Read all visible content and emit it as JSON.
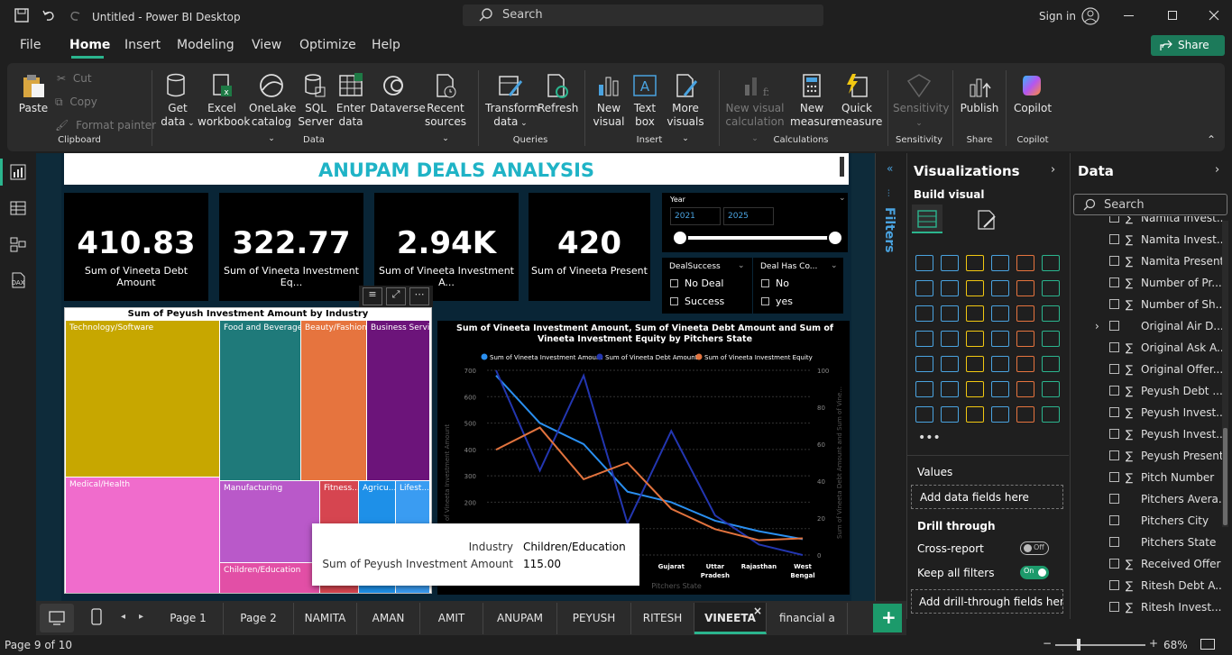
{
  "window": {
    "title": "Untitled - Power BI Desktop",
    "search_placeholder": "Search",
    "sign_in": "Sign in"
  },
  "menu": [
    "File",
    "Home",
    "Insert",
    "Modeling",
    "View",
    "Optimize",
    "Help"
  ],
  "share": "Share",
  "ribbon": {
    "clipboard": {
      "paste": "Paste",
      "cut": "Cut",
      "copy": "Copy",
      "format_painter": "Format painter",
      "group": "Clipboard"
    },
    "data": {
      "get_data": [
        "Get",
        "data"
      ],
      "excel": [
        "Excel",
        "workbook"
      ],
      "onelake": [
        "OneLake",
        "catalog"
      ],
      "sql": [
        "SQL",
        "Server"
      ],
      "enter": [
        "Enter",
        "data"
      ],
      "dataverse": "Dataverse",
      "recent": [
        "Recent",
        "sources"
      ],
      "group": "Data"
    },
    "queries": {
      "transform": [
        "Transform",
        "data"
      ],
      "refresh": "Refresh",
      "group": "Queries"
    },
    "insert": {
      "new_visual": [
        "New",
        "visual"
      ],
      "text_box": [
        "Text",
        "box"
      ],
      "more_visuals": [
        "More",
        "visuals"
      ],
      "group": "Insert"
    },
    "calculations": {
      "new_visual_calc": [
        "New visual",
        "calculation"
      ],
      "new_measure": [
        "New",
        "measure"
      ],
      "quick_measure": [
        "Quick",
        "measure"
      ],
      "group": "Calculations"
    },
    "sensitivity": {
      "label": "Sensitivity",
      "group": "Sensitivity"
    },
    "share": {
      "publish": "Publish",
      "group": "Share"
    },
    "copilot": {
      "label": "Copilot",
      "group": "Copilot"
    }
  },
  "report": {
    "title": "ANUPAM DEALS ANALYSIS",
    "kpis": [
      {
        "value": "410.83",
        "label": "Sum of Vineeta Debt Amount"
      },
      {
        "value": "322.77",
        "label": "Sum of Vineeta Investment Eq..."
      },
      {
        "value": "2.94K",
        "label": "Sum of Vineeta Investment A..."
      },
      {
        "value": "420",
        "label": "Sum of Vineeta Present"
      }
    ],
    "year_slicer": {
      "title": "Year",
      "from": "2021",
      "to": "2025"
    },
    "deal_success": {
      "title": "DealSuccess",
      "options": [
        "No Deal",
        "Success"
      ]
    },
    "deal_has_co": {
      "title": "Deal Has Co...",
      "options": [
        "No",
        "yes"
      ]
    },
    "treemap": {
      "title": "Sum of Peyush Investment Amount by Industry",
      "tiles": [
        "Technology/Software",
        "Food and Beverage",
        "Beauty/Fashion",
        "Business Servi...",
        "Medical/Health",
        "Manufacturing",
        "Fitness...",
        "Agricu...",
        "Lifest...",
        "Children/Education"
      ]
    },
    "tooltip": {
      "k1": "Industry",
      "v1": "Children/Education",
      "k2": "Sum of Peyush Investment Amount",
      "v2": "115.00"
    },
    "line_chart_title": "Sum of Vineeta Investment Amount, Sum of Vineeta Debt Amount and Sum of Vineeta Investment Equity by Pitchers State"
  },
  "chart_data": {
    "type": "line",
    "title": "Sum of Vineeta Investment Amount, Sum of Vineeta Debt Amount and Sum of Vineeta Investment Equity by Pitchers State",
    "xlabel": "Pitchers State",
    "ylabel": "Sum of Vineeta Investment Amount",
    "y2label": "Sum of Vineeta Debt Amount and Sum of Vine...",
    "categories": [
      "",
      "",
      "",
      "",
      "Gujarat",
      "Uttar Pradesh",
      "Rajasthan",
      "West Bengal"
    ],
    "series": [
      {
        "name": "Sum of Vineeta Investment Amount",
        "axis": "left",
        "color": "#2a8ff0",
        "values": [
          680,
          500,
          420,
          240,
          200,
          130,
          90,
          60
        ]
      },
      {
        "name": "Sum of Vineeta Debt Amount",
        "axis": "left",
        "color": "#2336b0",
        "values": [
          700,
          320,
          680,
          120,
          470,
          150,
          40,
          0
        ]
      },
      {
        "name": "Sum of Vineeta Investment Equity",
        "axis": "right",
        "color": "#e2733e",
        "values": [
          57,
          69,
          41,
          50,
          25,
          14,
          8,
          9
        ]
      }
    ],
    "ylim": [
      0,
      700
    ],
    "y2lim": [
      0,
      100
    ],
    "yticks": [
      "0",
      "100",
      "200",
      "300",
      "400",
      "500",
      "600",
      "700"
    ],
    "y2ticks": [
      "0",
      "20",
      "40",
      "60",
      "80",
      "100"
    ],
    "legend": "top"
  },
  "filters_label": "Filters",
  "visualizations": {
    "title": "Visualizations",
    "build_visual": "Build visual",
    "values": "Values",
    "add_data": "Add data fields here",
    "drill_through": "Drill through",
    "cross_report": "Cross-report",
    "cross_report_state": "Off",
    "keep_filters": "Keep all filters",
    "keep_filters_state": "On",
    "add_drill": "Add drill-through fields here"
  },
  "data_pane": {
    "title": "Data",
    "search_placeholder": "Search",
    "fields": [
      {
        "name": "Namita Invest...",
        "sigma": true
      },
      {
        "name": "Namita Invest...",
        "sigma": true
      },
      {
        "name": "Namita Present",
        "sigma": true
      },
      {
        "name": "Number of Pr...",
        "sigma": true
      },
      {
        "name": "Number of Sh...",
        "sigma": true
      },
      {
        "name": "Original Air D...",
        "sigma": false
      },
      {
        "name": "Original Ask A...",
        "sigma": true
      },
      {
        "name": "Original Offer...",
        "sigma": true
      },
      {
        "name": "Peyush Debt ...",
        "sigma": true
      },
      {
        "name": "Peyush Invest...",
        "sigma": true
      },
      {
        "name": "Peyush Invest...",
        "sigma": true
      },
      {
        "name": "Peyush Present",
        "sigma": true
      },
      {
        "name": "Pitch Number",
        "sigma": true
      },
      {
        "name": "Pitchers Avera...",
        "sigma": false
      },
      {
        "name": "Pitchers City",
        "sigma": false
      },
      {
        "name": "Pitchers State",
        "sigma": false
      },
      {
        "name": "Received Offer",
        "sigma": true
      },
      {
        "name": "Ritesh Debt A...",
        "sigma": true
      },
      {
        "name": "Ritesh Invest...",
        "sigma": true
      }
    ]
  },
  "tabs": [
    "Page 1",
    "Page 2",
    "NAMITA",
    "AMAN",
    "AMIT",
    "ANUPAM",
    "PEYUSH",
    "RITESH",
    "VINEETA",
    "financial a"
  ],
  "status": {
    "page": "Page 9 of 10",
    "zoom": "68%"
  }
}
